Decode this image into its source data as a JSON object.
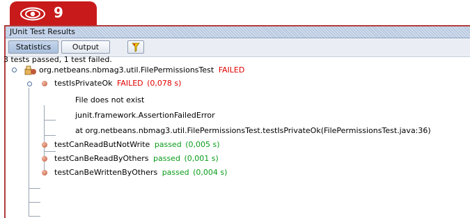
{
  "callout": {
    "number": "9",
    "icon": "eye-icon",
    "color": "#c81a1a"
  },
  "window": {
    "title": "JUnit Test Results"
  },
  "toolbar": {
    "statistics_label": "Statistics",
    "output_label": "Output",
    "filter_icon": "filter-funnel-icon"
  },
  "summary": "3 tests passed, 1 test failed.",
  "suite": {
    "name": "org.netbeans.nbmag3.util.FilePermissionsTest",
    "status": "FAILED"
  },
  "tests": [
    {
      "name": "testIsPrivateOk",
      "status": "FAILED",
      "time": "(0,078 s)",
      "details": [
        "File does not exist",
        "junit.framework.AssertionFailedError",
        "at org.netbeans.nbmag3.util.FilePermissionsTest.testIsPrivateOk(FilePermissionsTest.java:36)"
      ]
    },
    {
      "name": "testCanReadButNotWrite",
      "status": "passed",
      "time": "(0,005 s)"
    },
    {
      "name": "testCanBeReadByOthers",
      "status": "passed",
      "time": "(0,001 s)"
    },
    {
      "name": "testCanBeWrittenByOthers",
      "status": "passed",
      "time": "(0,004 s)"
    }
  ],
  "colors": {
    "failed": "#e00000",
    "passed": "#0a9c1a",
    "frame_border": "#b43c3c"
  }
}
